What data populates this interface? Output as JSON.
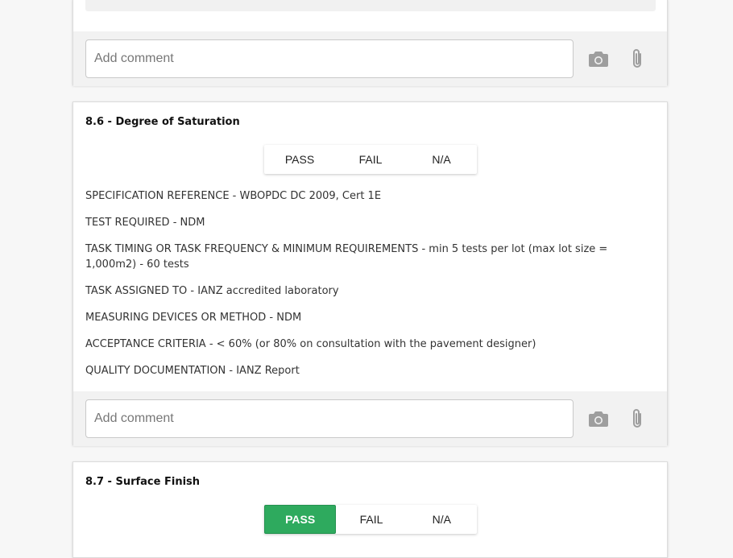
{
  "comment": {
    "placeholder": "Add comment"
  },
  "items": [
    {
      "title": "8.6 - Degree of Saturation",
      "options": [
        "PASS",
        "FAIL",
        "N/A"
      ],
      "selected": "",
      "details": [
        "SPECIFICATION REFERENCE - WBOPDC DC 2009, Cert 1E",
        "TEST REQUIRED - NDM",
        "TASK TIMING OR TASK FREQUENCY & MINIMUM REQUIREMENTS - min 5 tests per lot (max lot size = 1,000m2) - 60 tests",
        "TASK ASSIGNED TO - IANZ accredited laboratory",
        "MEASURING DEVICES OR METHOD - NDM",
        "ACCEPTANCE CRITERIA - < 60% (or 80% on consultation with the pavement designer)",
        "QUALITY DOCUMENTATION - IANZ Report"
      ]
    },
    {
      "title": "8.7 - Surface Finish",
      "options": [
        "PASS",
        "FAIL",
        "N/A"
      ],
      "selected": "PASS"
    }
  ],
  "colors": {
    "pass_active": "#2eaa5e",
    "icon": "#9e9e9e"
  },
  "icons": [
    "camera-icon",
    "paperclip-icon"
  ]
}
